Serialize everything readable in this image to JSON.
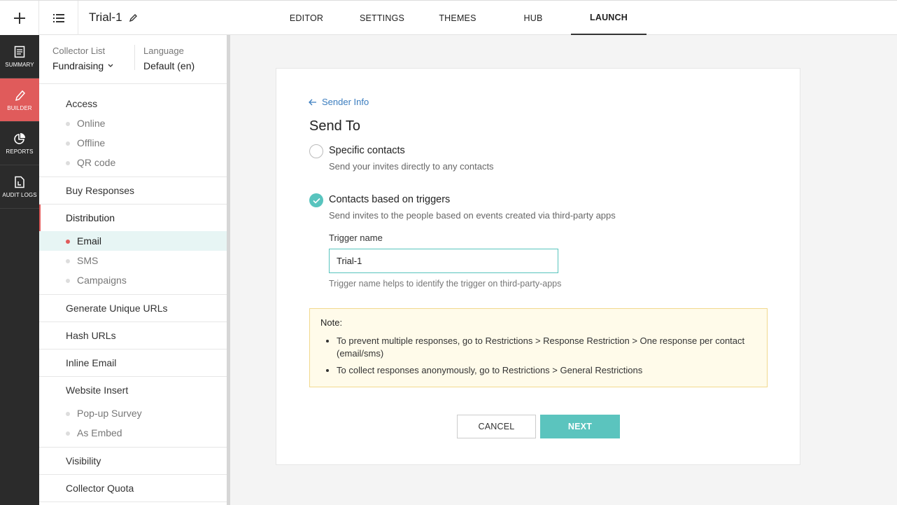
{
  "topbar": {
    "add_icon": "plus-icon",
    "menu_icon": "list-icon",
    "title": "Trial-1",
    "edit_icon": "pencil-icon",
    "tabs": [
      {
        "label": "EDITOR"
      },
      {
        "label": "SETTINGS"
      },
      {
        "label": "THEMES"
      },
      {
        "label": "HUB"
      },
      {
        "label": "LAUNCH",
        "active": true
      }
    ]
  },
  "rail": {
    "items": [
      {
        "label": "SUMMARY",
        "icon": "document-icon"
      },
      {
        "label": "BUILDER",
        "icon": "pencil-icon",
        "active": true
      },
      {
        "label": "REPORTS",
        "icon": "pie-chart-icon"
      },
      {
        "label": "AUDIT LOGS",
        "icon": "log-icon"
      }
    ]
  },
  "panel": {
    "collector_label": "Collector List",
    "collector_value": "Fundraising",
    "language_label": "Language",
    "language_value": "Default (en)",
    "sections": [
      {
        "label": "Access",
        "items": [
          "Online",
          "Offline",
          "QR code"
        ]
      },
      {
        "label": "Buy Responses",
        "items": []
      },
      {
        "label": "Distribution",
        "items": [
          "Email",
          "SMS",
          "Campaigns"
        ],
        "active_item": "Email"
      },
      {
        "label": "Generate Unique URLs",
        "items": []
      },
      {
        "label": "Hash URLs",
        "items": []
      },
      {
        "label": "Inline Email",
        "items": []
      },
      {
        "label": "Website Insert",
        "items": [
          "Pop-up Survey",
          "As Embed"
        ]
      },
      {
        "label": "Visibility",
        "items": []
      },
      {
        "label": "Collector Quota",
        "items": []
      }
    ]
  },
  "main": {
    "back_label": "Sender Info",
    "heading": "Send To",
    "option1_title": "Specific contacts",
    "option1_desc": "Send your invites directly to any contacts",
    "option2_title": "Contacts based on triggers",
    "option2_desc": "Send invites to the people based on events created via third-party apps",
    "trigger_label": "Trigger name",
    "trigger_value": "Trial-1",
    "trigger_help": "Trigger name helps to identify the trigger on third-party-apps",
    "note_title": "Note:",
    "note_item1": "To prevent multiple responses, go to Restrictions > Response Restriction > One response per contact (email/sms)",
    "note_item2": "To collect responses anonymously, go to Restrictions > General Restrictions",
    "cancel_label": "CANCEL",
    "next_label": "NEXT"
  },
  "colors": {
    "accent": "#58c4be",
    "builder_active": "#e05b5b",
    "rail_bg": "#2b2b2b",
    "link": "#3b7dbf",
    "note_bg": "#fffbea"
  }
}
